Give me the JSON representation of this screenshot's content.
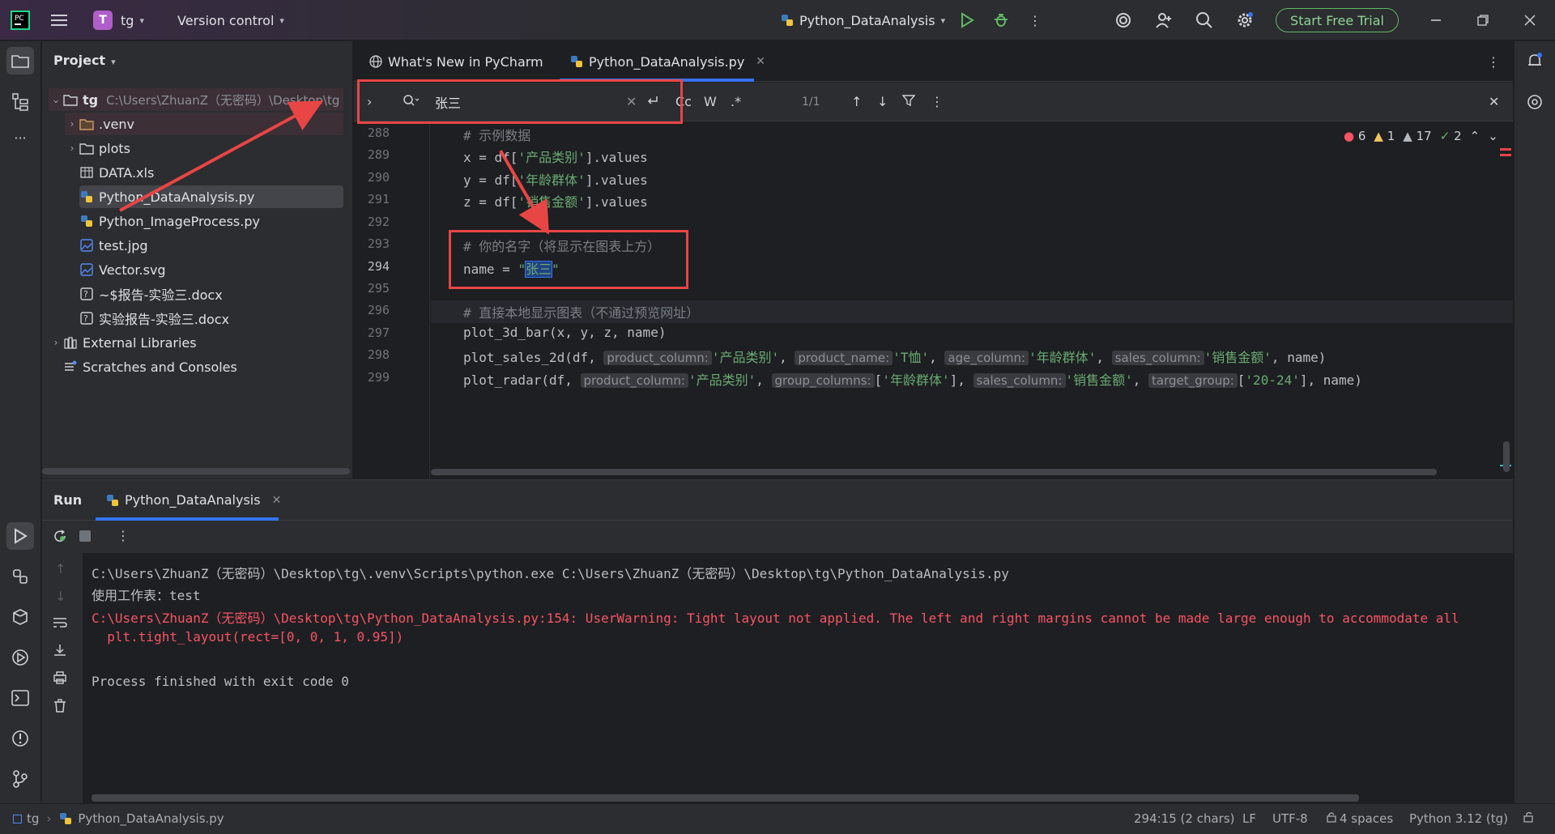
{
  "titlebar": {
    "project_badge": "T",
    "project_name": "tg",
    "vcs": "Version control",
    "run_config": "Python_DataAnalysis",
    "trial": "Start Free Trial"
  },
  "project_panel": {
    "title": "Project",
    "root_name": "tg",
    "root_path": "C:\\Users\\ZhuanZ（无密码）\\Desktop\\tg",
    "items": [
      {
        "label": ".venv",
        "kind": "folder-excluded"
      },
      {
        "label": "plots",
        "kind": "folder"
      },
      {
        "label": "DATA.xls",
        "kind": "table"
      },
      {
        "label": "Python_DataAnalysis.py",
        "kind": "python"
      },
      {
        "label": "Python_ImageProcess.py",
        "kind": "python"
      },
      {
        "label": "test.jpg",
        "kind": "image"
      },
      {
        "label": "Vector.svg",
        "kind": "image"
      },
      {
        "label": "~$报告-实验三.docx",
        "kind": "unknown"
      },
      {
        "label": "实验报告-实验三.docx",
        "kind": "unknown"
      },
      {
        "label": "External Libraries",
        "kind": "library"
      },
      {
        "label": "Scratches and Consoles",
        "kind": "scratch"
      }
    ]
  },
  "tabs": [
    {
      "label": "What's New in PyCharm"
    },
    {
      "label": "Python_DataAnalysis.py"
    }
  ],
  "find": {
    "query": "张三",
    "opt_case": "Cc",
    "opt_word": "W",
    "opt_regex": ".*",
    "match_count": "1/1"
  },
  "inspections": {
    "errors": "6",
    "warnings": "1",
    "weak": "17",
    "ok": "2"
  },
  "code": {
    "line_numbers": [
      "288",
      "289",
      "290",
      "291",
      "292",
      "293",
      "294",
      "295",
      "296",
      "297",
      "298",
      "299"
    ],
    "l288": "# 示例数据",
    "l289_a": "x = df[",
    "l289_s": "'产品类别'",
    "l289_b": "].values",
    "l290_a": "y = df[",
    "l290_s": "'年龄群体'",
    "l290_b": "].values",
    "l291_a": "z = df[",
    "l291_s": "'销售金额'",
    "l291_b": "].values",
    "l293": "# 你的名字（将显示在图表上方）",
    "l294_a": "name = ",
    "l294_q1": "\"",
    "l294_sel": "张三",
    "l294_q2": "\"",
    "l296": "# 直接本地显示图表（不通过预览网址）",
    "l297": "plot_3d_bar(x, y, z, name)",
    "l298": {
      "p1": "plot_sales_2d(df, ",
      "h1": "product_column:",
      "s1": "'产品类别'",
      "c1": ", ",
      "h2": "product_name:",
      "s2": "'T恤'",
      "c2": ", ",
      "h3": "age_column:",
      "s3": "'年龄群体'",
      "c3": ", ",
      "h4": "sales_column:",
      "s4": "'销售金额'",
      "end": ", name)"
    },
    "l299": {
      "p1": "plot_radar(df, ",
      "h1": "product_column:",
      "s1": "'产品类别'",
      "c1": ", ",
      "h2": "group_columns:",
      "s2a": "[",
      "s2": "'年龄群体'",
      "s2b": "], ",
      "h3": "sales_column:",
      "s3": "'销售金额'",
      "c3": ", ",
      "h4": "target_group:",
      "s4a": "[",
      "s4": "'20-24'",
      "end": "], name)"
    }
  },
  "run": {
    "title": "Run",
    "tab": "Python_DataAnalysis",
    "lines": [
      "C:\\Users\\ZhuanZ（无密码）\\Desktop\\tg\\.venv\\Scripts\\python.exe C:\\Users\\ZhuanZ（无密码）\\Desktop\\tg\\Python_DataAnalysis.py",
      "使用工作表：test",
      "C:\\Users\\ZhuanZ（无密码）\\Desktop\\tg\\Python_DataAnalysis.py:154: UserWarning: Tight layout not applied. The left and right margins cannot be made large enough to accommodate all",
      "  plt.tight_layout(rect=[0, 0, 1, 0.95])",
      "Process finished with exit code 0"
    ]
  },
  "statusbar": {
    "crumb_root": "tg",
    "crumb_file": "Python_DataAnalysis.py",
    "position": "294:15 (2 chars)",
    "line_sep": "LF",
    "encoding": "UTF-8",
    "indent": "4 spaces",
    "interpreter": "Python 3.12 (tg)"
  },
  "colors": {
    "accent": "#3574f0",
    "annotation": "#e84545",
    "error": "#f75464",
    "string": "#6aab73"
  }
}
